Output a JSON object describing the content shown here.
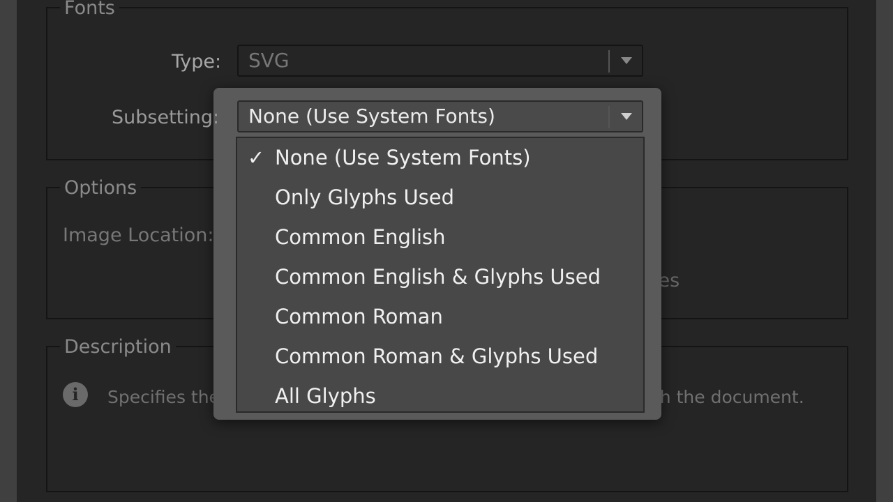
{
  "fonts_group": {
    "legend": "Fonts",
    "type_label": "Type:",
    "type_value": "SVG",
    "subsetting_label": "Subsetting:",
    "subsetting_value": "None (Use System Fonts)"
  },
  "options_group": {
    "legend": "Options",
    "image_location_label": "Image Location:",
    "partial_text": "ies"
  },
  "description_group": {
    "legend": "Description",
    "text_left": "Specifies the m",
    "text_right": "th the document.",
    "info_icon": "info-icon"
  },
  "subsetting_menu": {
    "items": [
      {
        "label": "None (Use System Fonts)",
        "checked": true,
        "check_glyph": "✓"
      },
      {
        "label": "Only Glyphs Used",
        "checked": false
      },
      {
        "label": "Common English",
        "checked": false
      },
      {
        "label": "Common English & Glyphs Used",
        "checked": false
      },
      {
        "label": "Common Roman",
        "checked": false
      },
      {
        "label": "Common Roman & Glyphs Used",
        "checked": false
      },
      {
        "label": "All Glyphs",
        "checked": false
      }
    ]
  },
  "colors": {
    "dialog_bg": "#252525",
    "menu_bg": "#484848",
    "popover_bg": "#5a5a5a",
    "text": "#bdbdbd",
    "menu_text": "#f0f0f0"
  }
}
